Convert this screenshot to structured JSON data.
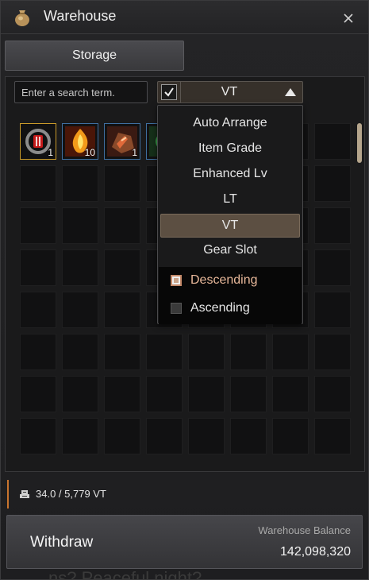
{
  "window": {
    "title": "Warehouse",
    "title_icon": "money-bag-icon",
    "close_icon": "close-icon"
  },
  "tabs": [
    {
      "label": "Storage",
      "active": true
    }
  ],
  "search": {
    "placeholder": "Enter a search term.",
    "value": ""
  },
  "sort": {
    "checked": true,
    "selected_label": "VT",
    "options": [
      "Auto Arrange",
      "Item Grade",
      "Enhanced Lv",
      "LT",
      "VT",
      "Gear Slot"
    ],
    "selected_index": 4,
    "order_options": [
      {
        "label": "Descending",
        "selected": true
      },
      {
        "label": "Ascending",
        "selected": false
      }
    ]
  },
  "inventory": {
    "items": [
      {
        "icon": "red-ring-icon",
        "quantity": "1",
        "grade": "gold"
      },
      {
        "icon": "fire-crystal-icon",
        "quantity": "10",
        "grade": "blue"
      },
      {
        "icon": "ore-chunk-icon",
        "quantity": "1",
        "grade": "blue"
      },
      {
        "icon": "green-item-icon",
        "quantity": "",
        "grade": "blue"
      }
    ]
  },
  "capacity": {
    "icon": "weight-icon",
    "text": "34.0 / 5,779 VT"
  },
  "footer": {
    "withdraw_label": "Withdraw",
    "balance_label": "Warehouse Balance",
    "balance_value": "142,098,320"
  },
  "background_text": "ns? Peaceful night?",
  "colors": {
    "accent": "#c9742e",
    "selected": "#5c4f42",
    "item_border": "#3f6fa0",
    "gold_border": "#c99a2a"
  }
}
